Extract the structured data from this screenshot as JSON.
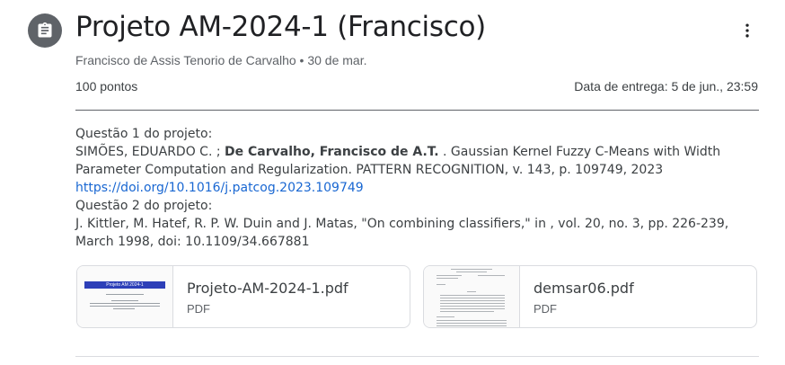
{
  "header": {
    "title": "Projeto AM-2024-1 (Francisco)",
    "author": "Francisco de Assis Tenorio de Carvalho",
    "separator": "•",
    "date": "30 de mar.",
    "points": "100 pontos",
    "due": "Data de entrega: 5 de jun., 23:59"
  },
  "description": {
    "q1_label": "Questão 1 do projeto:",
    "q1_authors_pre": "SIMÕES, EDUARDO C. ; ",
    "q1_authors_bold": "De Carvalho, Francisco de A.T.",
    "q1_citation": " . Gaussian Kernel Fuzzy C-Means with Width Parameter Computation and Regularization. PATTERN RECOGNITION, v. 143, p. 109749, 2023",
    "q1_link": "https://doi.org/10.1016/j.patcog.2023.109749",
    "q2_label": "Questão 2 do projeto:",
    "q2_citation": "J. Kittler, M. Hatef, R. P. W. Duin and J. Matas, \"On combining classifiers,\" in , vol. 20, no. 3, pp. 226-239, March 1998, doi: 10.1109/34.667881"
  },
  "attachments": [
    {
      "name": "Projeto-AM-2024-1.pdf",
      "type": "PDF",
      "thumb_title": "Projeto AM 2024-1"
    },
    {
      "name": "demsar06.pdf",
      "type": "PDF"
    }
  ],
  "icons": {
    "assignment": "assignment-icon",
    "more": "more-vert-icon"
  },
  "colors": {
    "icon_bg": "#5f6368",
    "link": "#1967d2",
    "thumb_bar": "#2d3fb8"
  }
}
